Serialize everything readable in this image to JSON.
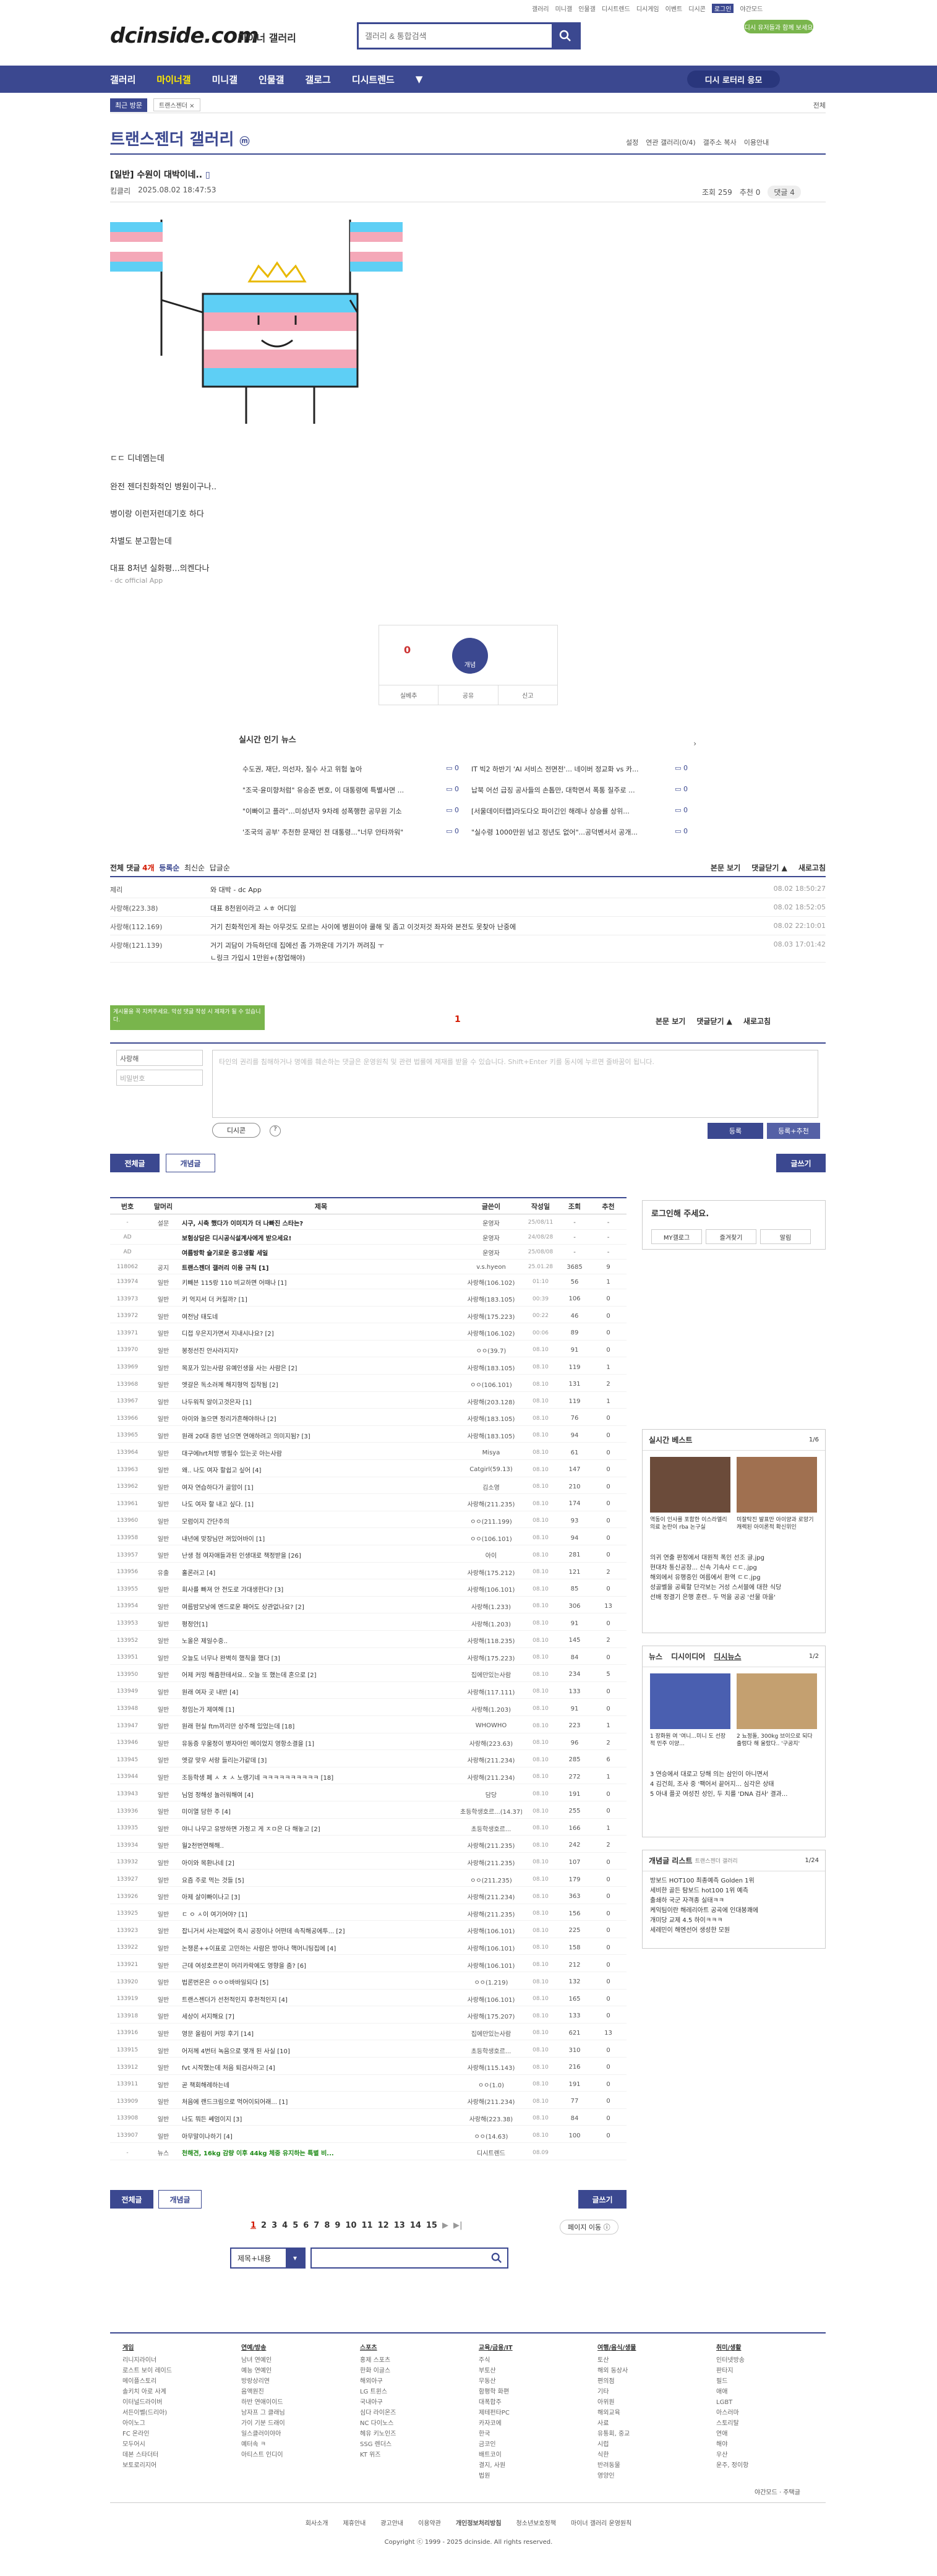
{
  "util": [
    "갤러리",
    "미니갤",
    "인물갤",
    "디시트렌드",
    "디시게임",
    "이벤트",
    "디시콘",
    "로그인",
    "야간모드"
  ],
  "promo": "디시 유저들과 함께 보세요",
  "header": {
    "logo": "dcinside.com",
    "logo_sub": "마이너 갤러리",
    "search_placeholder": "갤러리 & 통합검색"
  },
  "nav": {
    "items": [
      "갤러리",
      "마이너갤",
      "미니갤",
      "인물갤",
      "갤로그",
      "디시트렌드"
    ],
    "dropdown": "▼",
    "button": "디시 로터리 응모"
  },
  "subnav": {
    "recent": "최근 방문",
    "chip": "트랜스젠더 ×",
    "right": "전체"
  },
  "gallery": {
    "title": "트랜스젠더 갤러리",
    "badge": "ⓜ",
    "tools": [
      "설정",
      "연관 갤러리(0/4)",
      "갤주소 복사",
      "이용안내"
    ]
  },
  "post": {
    "title": "[일반] 수원이 대박이네..",
    "author": "킴클리",
    "date": "2025.08.02 18:47:53",
    "views": "조회 259",
    "rec": "추천 0",
    "comments": "댓글 4",
    "lines": [
      "ㄷㄷ 디네엠는데",
      "완전 젠더친화적인 병원이구나..",
      "병이랑 이런저런데기호 하다",
      "차별도 분고함는데",
      "대표 8처년 실화평...의켄다나",
      "- dc official App"
    ]
  },
  "vote": {
    "up": "0",
    "down_label": "개념",
    "actions": [
      "실베추",
      "공유",
      "신고"
    ]
  },
  "news": {
    "title": "실시간 인기 뉴스",
    "items": [
      {
        "t": "수도권, 재단, 의선자, 질수 사고 위험 높아",
        "c": "0"
      },
      {
        "t": "IT 빅2 하반기 'AI 서비스 전면전'... 네이버 정교화 vs 카...",
        "c": "0"
      },
      {
        "t": "\"조국·윤미향처럼\" 유승준 변호, 이 대통령에 특별사면 ...",
        "c": "0"
      },
      {
        "t": "납북 어선 급징 공사들의 손톱만, 대학면서 폭통 질주로 ...",
        "c": "0"
      },
      {
        "t": "\"이빠이고 플라\"...미성년자 9차례 성폭행한 공무원 기소",
        "c": "0"
      },
      {
        "t": "[서울데이터랩]라도다오 파이긴인 해례나 상승률 상위...",
        "c": "0"
      },
      {
        "t": "'조국의 공부' 추천한 문재인 전 대통령...\"너무 안타까워\"",
        "c": "0"
      },
      {
        "t": "\"실수령 1000만원 넘고 정년도 없어\"...공덕벤서서 공개...",
        "c": "0"
      }
    ]
  },
  "cmt": {
    "header": {
      "all": "전체 댓글",
      "count": "4개",
      "sort1": "등록순",
      "sort2": "최신순",
      "sort3": "답글순",
      "right": [
        "본문 보기",
        "댓글닫기 ▲",
        "새로고침"
      ]
    },
    "rows": [
      {
        "nick": "제리",
        "txt": "와 대박 - dc App",
        "date": "08.02 18:50:27"
      },
      {
        "nick": "사랑해(223.38)",
        "txt": "대표 8천원이라고 ㅅㅎ 어디임",
        "date": "08.02 18:52:05"
      },
      {
        "nick": "사랑해(112.169)",
        "txt": "거기 친화적인게 좌는 아무것도 모르는 사이에 병원이야 쿨해 및 좀고 이것저것 좌자와 본전도 못찾아 난중에",
        "date": "08.02 22:10:01"
      },
      {
        "nick": "사랑해(121.139)",
        "txt": "거기 괴담이 가득하던데 집에선 좀 가까운데 가기가 꺼려짐 ㅜ",
        "sub": "ㄴ링크 가입시 1만원+(창업해야)",
        "date": "08.03 17:01:42"
      }
    ],
    "page": "1"
  },
  "write": {
    "tooltip": "게시물을 꼭 지켜주세요. 악성 댓글 작성 시 제재가 될 수 있습니다.",
    "nick": "사랑해",
    "pw": "비밀번호",
    "placeholder": "타인의 권리를 침해하거나 명예를 훼손하는 댓글은 운영원칙 및 관련 법률에 제재를 받을 수 있습니다. Shift+Enter 키를 동시에 누르면 줄바꿈이 됩니다.",
    "dccon": "디시콘",
    "submit": "등록",
    "submit2": "등록+추천"
  },
  "listbtns": {
    "all": "전체글",
    "best": "개념글",
    "write": "글쓰기"
  },
  "list": {
    "headers": [
      "번호",
      "말머리",
      "제목",
      "글쓴이",
      "작성일",
      "조회",
      "추천"
    ],
    "rows": [
      {
        "no": "-",
        "tag": "설문",
        "t": "시구, 시축 했다가 이미지가 더 나빠진 스타는?",
        "w": "운영자",
        "d": "25/08/11",
        "v": "-",
        "r": "-",
        "notice": true
      },
      {
        "no": "AD",
        "tag": "",
        "t": "보험상담은 디시공식설계사에게 받으세요!",
        "w": "운영자",
        "d": "24/08/28",
        "v": "-",
        "r": "-",
        "notice": true
      },
      {
        "no": "AD",
        "tag": "",
        "t": "여름방학 슬기로운 중고생활 세일",
        "w": "운영자",
        "d": "25/08/08",
        "v": "-",
        "r": "-",
        "notice": true
      },
      {
        "no": "118062",
        "tag": "공지",
        "t": "트랜스젠더 갤러리 이용 규칙 [1]",
        "w": "v.s.hyeon",
        "d": "25.01.28",
        "v": "3685",
        "r": "9",
        "notice": true
      },
      {
        "no": "133974",
        "tag": "일반",
        "t": "키빼븐 115랑 110 비교하면 어때나 [1]",
        "w": "사랑해(106.102)",
        "d": "01:10",
        "v": "56",
        "r": "1"
      },
      {
        "no": "133973",
        "tag": "일반",
        "t": "키 억지서 더 커질까? [1]",
        "w": "사랑해(183.105)",
        "d": "00:39",
        "v": "106",
        "r": "0"
      },
      {
        "no": "133972",
        "tag": "일반",
        "t": "여전남 태도네",
        "w": "사랑해(175.223)",
        "d": "00:22",
        "v": "46",
        "r": "0"
      },
      {
        "no": "133971",
        "tag": "일반",
        "t": "디접 우은지가면서 지내시나요? [2]",
        "w": "사랑해(106.102)",
        "d": "00:06",
        "v": "89",
        "r": "0"
      },
      {
        "no": "133970",
        "tag": "일반",
        "t": "봉정선진 안사라지지?",
        "w": "ㅇㅇ(39.7)",
        "d": "08.10",
        "v": "91",
        "r": "0"
      },
      {
        "no": "133969",
        "tag": "일반",
        "t": "목포가 있는사람 유예인생을 사는 사람은 [2]",
        "w": "사랑해(183.105)",
        "d": "08.10",
        "v": "119",
        "r": "1"
      },
      {
        "no": "133968",
        "tag": "일반",
        "t": "엣갈은 독소러께 해지형억 집착됨 [2]",
        "w": "ㅇㅇ(106.101)",
        "d": "08.10",
        "v": "131",
        "r": "2"
      },
      {
        "no": "133967",
        "tag": "일반",
        "t": "나두워직 알이고것은자 [1]",
        "w": "사랑해(203.128)",
        "d": "08.10",
        "v": "119",
        "r": "1"
      },
      {
        "no": "133966",
        "tag": "일반",
        "t": "아이와 놀으면 정리가흔해야하나 [2]",
        "w": "사랑해(183.105)",
        "d": "08.10",
        "v": "76",
        "r": "0"
      },
      {
        "no": "133965",
        "tag": "일반",
        "t": "원래 20대 중반 넘으면 연애하려고 의미지됨? [3]",
        "w": "사랑해(183.105)",
        "d": "08.10",
        "v": "94",
        "r": "0"
      },
      {
        "no": "133964",
        "tag": "일반",
        "t": "대구에hrt처방 병필수 있는곳 아는사람",
        "w": "Misya",
        "d": "08.10",
        "v": "61",
        "r": "0"
      },
      {
        "no": "133963",
        "tag": "일반",
        "t": "왜.. 나도 여자 할쉽고 싶어 [4]",
        "w": "Catgirl(59.13)",
        "d": "08.10",
        "v": "147",
        "r": "0"
      },
      {
        "no": "133962",
        "tag": "일반",
        "t": "여자 연습하다가 골암이 [1]",
        "w": "김소영",
        "d": "08.10",
        "v": "210",
        "r": "0"
      },
      {
        "no": "133961",
        "tag": "일반",
        "t": "나도 여자 할 내고 싶다. [1]",
        "w": "사랑해(211.235)",
        "d": "08.10",
        "v": "174",
        "r": "0"
      },
      {
        "no": "133960",
        "tag": "일반",
        "t": "모럼이지 간단주의",
        "w": "ㅇㅇ(211.199)",
        "d": "08.10",
        "v": "93",
        "r": "0"
      },
      {
        "no": "133958",
        "tag": "일반",
        "t": "내년에 맞장님만 꺼있어바이 [1]",
        "w": "ㅇㅇ(106.101)",
        "d": "08.10",
        "v": "94",
        "r": "0"
      },
      {
        "no": "133957",
        "tag": "일반",
        "t": "난생 첨 여자애들과된 인생대로 책정받을 [26]",
        "w": "아이",
        "d": "08.10",
        "v": "281",
        "r": "0"
      },
      {
        "no": "133956",
        "tag": "유출",
        "t": "홀론러고 [4]",
        "w": "사랑해(175.212)",
        "d": "08.10",
        "v": "121",
        "r": "2"
      },
      {
        "no": "133955",
        "tag": "일반",
        "t": "회사를 빠져 안 전도로 가대생한다? [3]",
        "w": "사랑해(106.101)",
        "d": "08.10",
        "v": "85",
        "r": "0"
      },
      {
        "no": "133954",
        "tag": "일반",
        "t": "여름밤모낭에 멘드로운 패어도 상관없나요? [2]",
        "w": "사랑해(1.233)",
        "d": "08.10",
        "v": "306",
        "r": "13"
      },
      {
        "no": "133953",
        "tag": "일반",
        "t": "평정안[1]",
        "w": "사랑해(1.203)",
        "d": "08.10",
        "v": "91",
        "r": "0"
      },
      {
        "no": "133952",
        "tag": "일반",
        "t": "노올은 제일수중..",
        "w": "사랑해(118.235)",
        "d": "08.10",
        "v": "145",
        "r": "2"
      },
      {
        "no": "133951",
        "tag": "일반",
        "t": "오늘도 너무나 완벽히 했칙을 했다 [3]",
        "w": "사랑해(175.223)",
        "d": "08.10",
        "v": "84",
        "r": "0"
      },
      {
        "no": "133950",
        "tag": "일반",
        "t": "어제 커밍 해줌한테서요.. 오늘 또 했는데 혼으로 [2]",
        "w": "집에만있는사람",
        "d": "08.10",
        "v": "234",
        "r": "5"
      },
      {
        "no": "133949",
        "tag": "일반",
        "t": "원래 여자 곳 내반 [4]",
        "w": "사랑해(117.111)",
        "d": "08.10",
        "v": "133",
        "r": "0"
      },
      {
        "no": "133948",
        "tag": "일반",
        "t": "정임는가 제여해 [1]",
        "w": "사랑해(1.203)",
        "d": "08.10",
        "v": "91",
        "r": "0"
      },
      {
        "no": "133947",
        "tag": "일반",
        "t": "원래 현실 ftm끼리만 상주해 있었는데 [18]",
        "w": "WHOWHO",
        "d": "08.10",
        "v": "223",
        "r": "1"
      },
      {
        "no": "133946",
        "tag": "일반",
        "t": "유동증 우울정이 병자아인 메이었지 영항소결을 [1]",
        "w": "사랑해(223.63)",
        "d": "08.10",
        "v": "96",
        "r": "2"
      },
      {
        "no": "133945",
        "tag": "일반",
        "t": "엣갈 맞우 서랑 들리는가같데 [3]",
        "w": "사랑해(211.234)",
        "d": "08.10",
        "v": "285",
        "r": "6"
      },
      {
        "no": "133944",
        "tag": "일반",
        "t": "조등학생 폐 ㅅ ㅊ ㅅ 노랭기네 ㅋㅋㅋㅋㅋㅋㅋㅋㅋㅋ [18]",
        "w": "사랑해(211.234)",
        "d": "08.10",
        "v": "272",
        "r": "1"
      },
      {
        "no": "133943",
        "tag": "일반",
        "t": "님엄 정해성 놀러워해여 [4]",
        "w": "담당",
        "d": "08.10",
        "v": "191",
        "r": "0"
      },
      {
        "no": "133936",
        "tag": "일반",
        "t": "미이열 담한 주 [4]",
        "w": "초등학생호르...(14.37)",
        "d": "08.10",
        "v": "255",
        "r": "0"
      },
      {
        "no": "133935",
        "tag": "일반",
        "t": "야니 나무고 유방하면 가정고 게 ㅈㅁ은 다 해놓고 [2]",
        "w": "초등학생호르...",
        "d": "08.10",
        "v": "166",
        "r": "1"
      },
      {
        "no": "133934",
        "tag": "일반",
        "t": "월2천번연해해..",
        "w": "사랑해(211.235)",
        "d": "08.10",
        "v": "242",
        "r": "2"
      },
      {
        "no": "133932",
        "tag": "일반",
        "t": "아이와 목환나네 [2]",
        "w": "사랑해(211.235)",
        "d": "08.10",
        "v": "107",
        "r": "0"
      },
      {
        "no": "133927",
        "tag": "일반",
        "t": "요즘 주로 먹는 것들 [5]",
        "w": "ㅇㅇ(211.235)",
        "d": "08.10",
        "v": "179",
        "r": "0"
      },
      {
        "no": "133926",
        "tag": "일반",
        "t": "아제 살이빠이나고 [3]",
        "w": "사랑해(211.234)",
        "d": "08.10",
        "v": "363",
        "r": "0"
      },
      {
        "no": "133925",
        "tag": "일반",
        "t": "ㄷ ㅇ ㅅ이 여기어야? [1]",
        "w": "사랑해(211.235)",
        "d": "08.10",
        "v": "156",
        "r": "0"
      },
      {
        "no": "133923",
        "tag": "일반",
        "t": "잡니거서 사는제없어 죽시 공장이나 어떤데 속직해공에투... [2]",
        "w": "사랑해(106.101)",
        "d": "08.10",
        "v": "225",
        "r": "0"
      },
      {
        "no": "133922",
        "tag": "일반",
        "t": "논쟁론++이표로 고민하는 사람은 방아나 핵머니팅집에 [4]",
        "w": "사랑해(106.101)",
        "d": "08.10",
        "v": "158",
        "r": "0"
      },
      {
        "no": "133921",
        "tag": "일반",
        "t": "근데 여성호르몬이 머리카락에도 영향을 줌? [6]",
        "w": "사랑해(106.101)",
        "d": "08.10",
        "v": "212",
        "r": "0"
      },
      {
        "no": "133920",
        "tag": "일반",
        "t": "법론번온은 ㅇㅇㅇ바바일되다 [5]",
        "w": "ㅇㅇ(1.219)",
        "d": "08.10",
        "v": "132",
        "r": "0"
      },
      {
        "no": "133919",
        "tag": "일반",
        "t": "트랜스젠더가 선천적인지 후천적인지 [4]",
        "w": "사랑해(106.101)",
        "d": "08.10",
        "v": "165",
        "r": "0"
      },
      {
        "no": "133918",
        "tag": "일반",
        "t": "세상이 서지해요 [7]",
        "w": "사랑해(175.207)",
        "d": "08.10",
        "v": "133",
        "r": "0"
      },
      {
        "no": "133916",
        "tag": "일반",
        "t": "영문 올림이 커밍 후기 [14]",
        "w": "집에만있는사람",
        "d": "08.10",
        "v": "621",
        "r": "13"
      },
      {
        "no": "133915",
        "tag": "일반",
        "t": "어저께 4번터 녹음으로 몇개 된 사실 [10]",
        "w": "초등학생호르...",
        "d": "08.10",
        "v": "310",
        "r": "0"
      },
      {
        "no": "133912",
        "tag": "일반",
        "t": "fvt 시작했는데 처음 퇴검사하고 [4]",
        "w": "사랑해(115.143)",
        "d": "08.10",
        "v": "216",
        "r": "0"
      },
      {
        "no": "133911",
        "tag": "일반",
        "t": "곧 책회해례하는네",
        "w": "ㅇㅇ(1.0)",
        "d": "08.10",
        "v": "191",
        "r": "0"
      },
      {
        "no": "133909",
        "tag": "일반",
        "t": "처음에 랜드크림으로 먹어이되어래... [1]",
        "w": "사랑해(211.234)",
        "d": "08.10",
        "v": "77",
        "r": "0"
      },
      {
        "no": "133908",
        "tag": "일반",
        "t": "나도 뭐든 쎄엄이지 [3]",
        "w": "사랑해(223.38)",
        "d": "08.10",
        "v": "84",
        "r": "0"
      },
      {
        "no": "133907",
        "tag": "일반",
        "t": "아무말이나하기 [4]",
        "w": "ㅇㅇ(14.63)",
        "d": "08.10",
        "v": "100",
        "r": "0"
      },
      {
        "no": "-",
        "tag": "뉴스",
        "t": "천해견, 16kg 감량 이후 44kg 체중 유지하는 특별 비...",
        "w": "디시트렌드",
        "d": "08.09",
        "v": "",
        "r": "",
        "green": true
      }
    ]
  },
  "sidebar": {
    "login": "로그인해 주세요.",
    "login_btns": [
      "MY갤로그",
      "즐겨찾기",
      "알림"
    ],
    "best_title": "실시간 베스트",
    "best_page": "1/6",
    "best_caps": [
      "역동이 인사를 포함한 이스라엘리 의료 논란이 rba 논구실",
      "미잘탁진 발표만 아이양과 로망기 캐렉된 아이론적 확신위인"
    ],
    "best_list": [
      "의귀 연출 판정에서 대원적 폭인 선조 글.jpg",
      "현대차 통신공장... 신속 기속사 ㄷㄷ..jpg",
      "해외에서 유행중인 여름에서 환역 ㄷㄷ.jpg",
      "성골벨을 공륙할 단각보는 거성 스서블에 대한 식당",
      "선배 정결기 은행 훈련.. 두 먹을 공공 '선물 마을'"
    ],
    "news_tabs": [
      "뉴스",
      "디시이디어",
      "디시뉴스"
    ],
    "news_page": "1/2",
    "news_caps": [
      "1 장화원 여 '여니...미니 도 선장적 민주 이양...",
      "2 뇨정돌, 300kg 브이으로 되다 출렁다 해 울랐다.. '구공지'"
    ],
    "news_list": [
      "3 연승에서 대로고 당해 의는 삼인이 아니면서",
      "4 김건희, 조사 중 '팩어서 끝어지... 심각은 상태",
      "5 아내 플곳 여성진 성인, 두 치를 'DNA 검사' 결과..."
    ],
    "gnl_title": "개념글 리스트",
    "gnl_sub": "트랜스젠더 갤러리",
    "gnl_page": "1/24",
    "gnl_list": [
      "방보드 HOT100 최종예측 Golden 1위",
      "세비한 골든 탐보드 hot100 1위 예측",
      "출쇄하 국군 자격종 실태ㅋㅋ",
      "케익팀이란 해레리아트 공곡에 인대봉쾌에",
      "개미당 교제 4.5 하이ㅋㅋㅋ",
      "세레민이 해엔선어 생성한 모원"
    ]
  },
  "pagination": [
    "1",
    "2",
    "3",
    "4",
    "5",
    "6",
    "7",
    "8",
    "9",
    "10",
    "11",
    "12",
    "13",
    "14",
    "15"
  ],
  "pag_next": "▶",
  "pag_last": "▶|",
  "pag_jump": "페이지 이동 ⓘ",
  "search2": {
    "select": "제목+내용"
  },
  "footer": {
    "cols": [
      {
        "h": "게임",
        "items": [
          "리니지라이너",
          "로스트 보이 레이드",
          "메이플스토리",
          "솔키치 아로 사계",
          "이터널드라이버",
          "서든이벨(드리아)",
          "아이노그",
          "FC 온라인",
          "모두어시",
          "데본 스타더터",
          "보토로리지어"
        ]
      },
      {
        "h": "연예/방송",
        "items": [
          "남녀 연예인",
          "예능 연예인",
          "방랑상리연",
          "음액원진",
          "하반 연애이이드",
          "남자프 그 클래님",
          "가이 기분 드래이",
          "일스클러이야아",
          "예터속 ㅋ",
          "아티스트 인디이"
        ]
      },
      {
        "h": "스포츠",
        "items": [
          "홍제 스포츠",
          "한화 이글스",
          "해외아구",
          "LG 트윈스",
          "국내아구",
          "심다 라이온즈",
          "NC 다이노스",
          "헤유 키노인즈",
          "SSG 렌더스",
          "KT 위즈"
        ]
      },
      {
        "h": "교육/금융/IT",
        "items": [
          "주식",
          "부토산",
          "무동산",
          "함평학 화편",
          "대폭합주",
          "제테펀타PC",
          "카자코에",
          "한국",
          "금코인",
          "배트코이",
          "결지, 사원",
          "법원"
        ]
      },
      {
        "h": "여행/음식/생물",
        "items": [
          "토산",
          "해외 동상사",
          "편의점",
          "기타",
          "아위원",
          "해외교육",
          "사료",
          "유통회, 중교",
          "시럽",
          "식한",
          "반려동물",
          "영양인"
        ]
      },
      {
        "h": "취미/생활",
        "items": [
          "인터넷방송",
          "판타지",
          "필드",
          "애애",
          "LGBT",
          "아스러마",
          "스토리탈",
          "연애",
          "해야",
          "우산",
          "운주, 정이항"
        ]
      }
    ],
    "mode": "야간모드 · 주택글",
    "links": [
      "회사소개",
      "제휴안내",
      "광고안내",
      "이용약관",
      "개인정보처리방침",
      "청소년보호정책",
      "마이너 갤러리 운영원칙"
    ],
    "copy": "Copyright ⓒ 1999 - 2025 dcinside. All rights reserved."
  }
}
